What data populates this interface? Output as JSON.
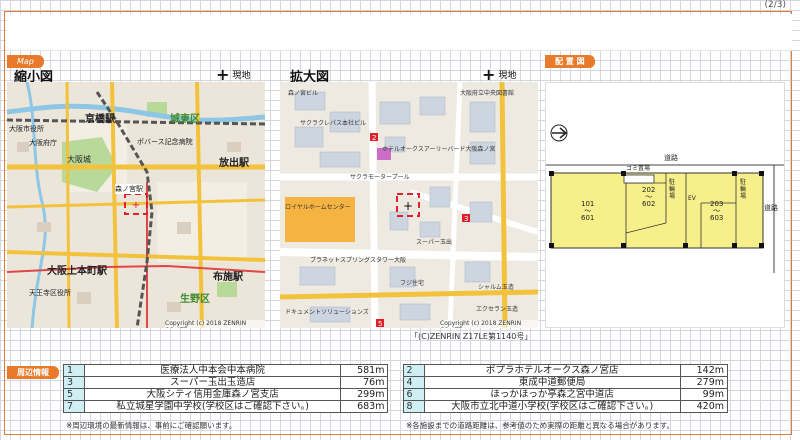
{
  "page_number": "(2/3)",
  "tags": {
    "map": "Map",
    "layout": "配 置 図",
    "nearby": "周辺情報"
  },
  "maps": {
    "small_label": "縮小図",
    "large_label": "拡大図",
    "current_position": "現地",
    "copyright": "Copyright (c) 2018 ZENRIN CO.,LTD.",
    "zenrin_credit": "「(C)ZENRIN Z17LE第1140号」",
    "small_places": [
      {
        "name": "京橋駅"
      },
      {
        "name": "城東区"
      },
      {
        "name": "大阪府庁"
      },
      {
        "name": "大阪城"
      },
      {
        "name": "ポバース記念病院"
      },
      {
        "name": "放出駅"
      },
      {
        "name": "森ノ宮駅"
      },
      {
        "name": "大阪上本町駅"
      },
      {
        "name": "布施駅"
      },
      {
        "name": "天王寺区役所"
      },
      {
        "name": "生野区"
      },
      {
        "name": "大阪市役所"
      }
    ],
    "large_places": [
      {
        "name": "サクラクレパス本社ビル"
      },
      {
        "name": "ホテルオークスアーリーバード大阪森ノ宮"
      },
      {
        "name": "サクラモータープール"
      },
      {
        "name": "ロイヤルホームセンター"
      },
      {
        "name": "スーパー玉出"
      },
      {
        "name": "プラネットスプリングスタワー大阪"
      },
      {
        "name": "森ノ宮ビル"
      },
      {
        "name": "ドキュメントソリューションズ"
      },
      {
        "name": "大阪府立中央図書館"
      },
      {
        "name": "フジ住宅"
      },
      {
        "name": "シャルム玉造"
      },
      {
        "name": "エクセラン玉造"
      }
    ]
  },
  "layout_diagram": {
    "road_top": "道路",
    "road_right": "道路",
    "trash": "ゴミ置場",
    "parking_1": "駐輪場",
    "parking_2": "駐輪場",
    "ev": "EV",
    "unit_101": "101\n〜\n601",
    "unit_202": "202\n〜\n602",
    "unit_203": "203\n〜\n603"
  },
  "nearby": {
    "rows": [
      {
        "left": {
          "no": "1",
          "name": "医療法人中本会中本病院",
          "dist": "581m"
        },
        "right": {
          "no": "2",
          "name": "ポプラホテルオークス森ノ宮店",
          "dist": "142m"
        }
      },
      {
        "left": {
          "no": "3",
          "name": "スーパー玉出玉造店",
          "dist": "76m"
        },
        "right": {
          "no": "4",
          "name": "東成中道郵便局",
          "dist": "279m"
        }
      },
      {
        "left": {
          "no": "5",
          "name": "大阪シティ信用金庫森ノ宮支店",
          "dist": "299m"
        },
        "right": {
          "no": "6",
          "name": "ほっかほっか亭森之宮中道店",
          "dist": "99m"
        }
      },
      {
        "left": {
          "no": "7",
          "name": "私立城星学園中学校(学校区はご確認下さい。)",
          "dist": "683m"
        },
        "right": {
          "no": "8",
          "name": "大阪市立北中道小学校(学校区はご確認下さい。)",
          "dist": "420m"
        }
      }
    ],
    "note_left": "※周辺環境の最新情報は、事前にご確認願います。",
    "note_right": "※各施設までの道路距離は、参考値のため実際の距離と異なる場合があります。"
  },
  "colors": {
    "accent": "#e87a2b",
    "table_num_bg": "#cfeff5",
    "unit_fill": "#f7f08a"
  }
}
